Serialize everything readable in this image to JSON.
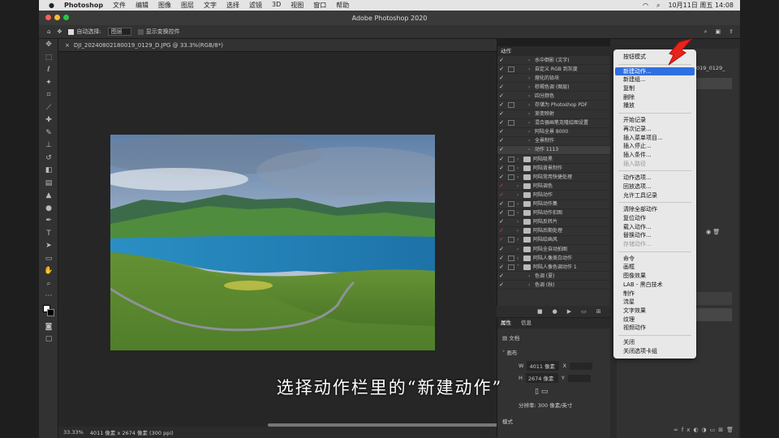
{
  "menubar": {
    "app_name": "Photoshop",
    "items": [
      "文件",
      "编辑",
      "图像",
      "图层",
      "文字",
      "选择",
      "滤镜",
      "3D",
      "视图",
      "窗口",
      "帮助"
    ],
    "datetime": "10月11日 周五  14:08"
  },
  "window": {
    "title": "Adobe Photoshop 2020"
  },
  "options_bar": {
    "auto_select_label": "自动选择:",
    "auto_select_value": "图层",
    "show_transform_label": "显示变换控件"
  },
  "document": {
    "tab_title": "DJI_20240802180019_0129_D.JPG @ 33.3%(RGB/8*)",
    "zoom": "33.33%",
    "info": "4011 像素 x 2674 像素 (300 ppi)"
  },
  "right_tab_title": "019_0129_",
  "subtitle": "选择动作栏里的“新建动作”",
  "actions_panel": {
    "tab": "动作",
    "rows": [
      {
        "label": "水中倒影 (文字)",
        "type": "item",
        "dialog": false
      },
      {
        "label": "自定义 RGB 到灰度",
        "type": "item",
        "dialog": true
      },
      {
        "label": "熔化的铅块",
        "type": "item",
        "dialog": false
      },
      {
        "label": "棕褐色调 (图层)",
        "type": "item",
        "dialog": false
      },
      {
        "label": "四分颜色",
        "type": "item",
        "dialog": false
      },
      {
        "label": "存储为 Photoshop PDF",
        "type": "item",
        "dialog": true
      },
      {
        "label": "渐变映射",
        "type": "item",
        "dialog": false
      },
      {
        "label": "混合器画笔克隆绘图设置",
        "type": "item",
        "dialog": true
      },
      {
        "label": "阿陆全景 8000",
        "type": "item",
        "dialog": false
      },
      {
        "label": "全景制作",
        "type": "item",
        "dialog": false
      },
      {
        "label": "动作 1113",
        "type": "item",
        "dialog": false,
        "highlight": true
      },
      {
        "label": "阿陆吸黑",
        "type": "set",
        "dialog": true
      },
      {
        "label": "阿陆背景制作",
        "type": "set",
        "dialog": true
      },
      {
        "label": "阿陆常用快捷处理",
        "type": "set",
        "dialog": true
      },
      {
        "label": "阿陆调色",
        "type": "set",
        "dialog": false,
        "red": true
      },
      {
        "label": "阿陆动作",
        "type": "set",
        "dialog": false,
        "red": true
      },
      {
        "label": "阿陆动作集",
        "type": "set",
        "dialog": true
      },
      {
        "label": "阿陆动作扣图",
        "type": "set",
        "dialog": true
      },
      {
        "label": "阿陆反转片",
        "type": "set",
        "dialog": false
      },
      {
        "label": "阿陆后期处理",
        "type": "set",
        "dialog": false,
        "red": true
      },
      {
        "label": "阿陆绘画风",
        "type": "set",
        "dialog": true,
        "red": true
      },
      {
        "label": "阿陆全自动拍图",
        "type": "set",
        "dialog": false
      },
      {
        "label": "阿陆人像美白动作",
        "type": "set",
        "dialog": true
      },
      {
        "label": "阿陆人像色调动作 1",
        "type": "set",
        "dialog": true,
        "open": true
      },
      {
        "label": "色调 (夏)",
        "type": "item",
        "dialog": false
      },
      {
        "label": "色调 (秋)",
        "type": "item",
        "dialog": false
      }
    ]
  },
  "properties_panel": {
    "tabs": [
      "属性",
      "信息"
    ],
    "doc_label": "文档",
    "canvas_label": "画布",
    "width_label": "W",
    "width_value": "4011 像素",
    "x_label": "X",
    "height_label": "H",
    "height_value": "2674 像素",
    "y_label": "Y",
    "resolution": "分辨率: 300 像素/英寸",
    "mode_label": "模式"
  },
  "flyout_menu": {
    "groups": [
      [
        {
          "label": "按钮模式",
          "enabled": true
        }
      ],
      [
        {
          "label": "新建动作...",
          "enabled": true,
          "active": true
        },
        {
          "label": "新建组...",
          "enabled": true
        },
        {
          "label": "复制",
          "enabled": true
        },
        {
          "label": "删除",
          "enabled": true
        },
        {
          "label": "播放",
          "enabled": true
        }
      ],
      [
        {
          "label": "开始记录",
          "enabled": true
        },
        {
          "label": "再次记录...",
          "enabled": true
        },
        {
          "label": "插入菜单项目...",
          "enabled": true
        },
        {
          "label": "插入停止...",
          "enabled": true
        },
        {
          "label": "插入条件...",
          "enabled": true
        },
        {
          "label": "插入路径",
          "enabled": false
        }
      ],
      [
        {
          "label": "动作选项...",
          "enabled": true
        },
        {
          "label": "回放选项...",
          "enabled": true
        },
        {
          "label": "允许工具记录",
          "enabled": true
        }
      ],
      [
        {
          "label": "清除全部动作",
          "enabled": true
        },
        {
          "label": "复位动作",
          "enabled": true
        },
        {
          "label": "载入动作...",
          "enabled": true
        },
        {
          "label": "替换动作...",
          "enabled": true
        },
        {
          "label": "存储动作...",
          "enabled": false
        }
      ],
      [
        {
          "label": "命令",
          "enabled": true
        },
        {
          "label": "画框",
          "enabled": true
        },
        {
          "label": "图像效果",
          "enabled": true
        },
        {
          "label": "LAB - 黑白技术",
          "enabled": true
        },
        {
          "label": "制作",
          "enabled": true
        },
        {
          "label": "流星",
          "enabled": true
        },
        {
          "label": "文字效果",
          "enabled": true
        },
        {
          "label": "纹理",
          "enabled": true
        },
        {
          "label": "视频动作",
          "enabled": true
        }
      ],
      [
        {
          "label": "关闭",
          "enabled": true
        },
        {
          "label": "关闭选项卡组",
          "enabled": true
        }
      ]
    ]
  },
  "colors": {
    "accent": "#2f6fe0",
    "arrow": "#e8231a",
    "panel": "#323232",
    "menu_bg": "#e8e8e8"
  }
}
